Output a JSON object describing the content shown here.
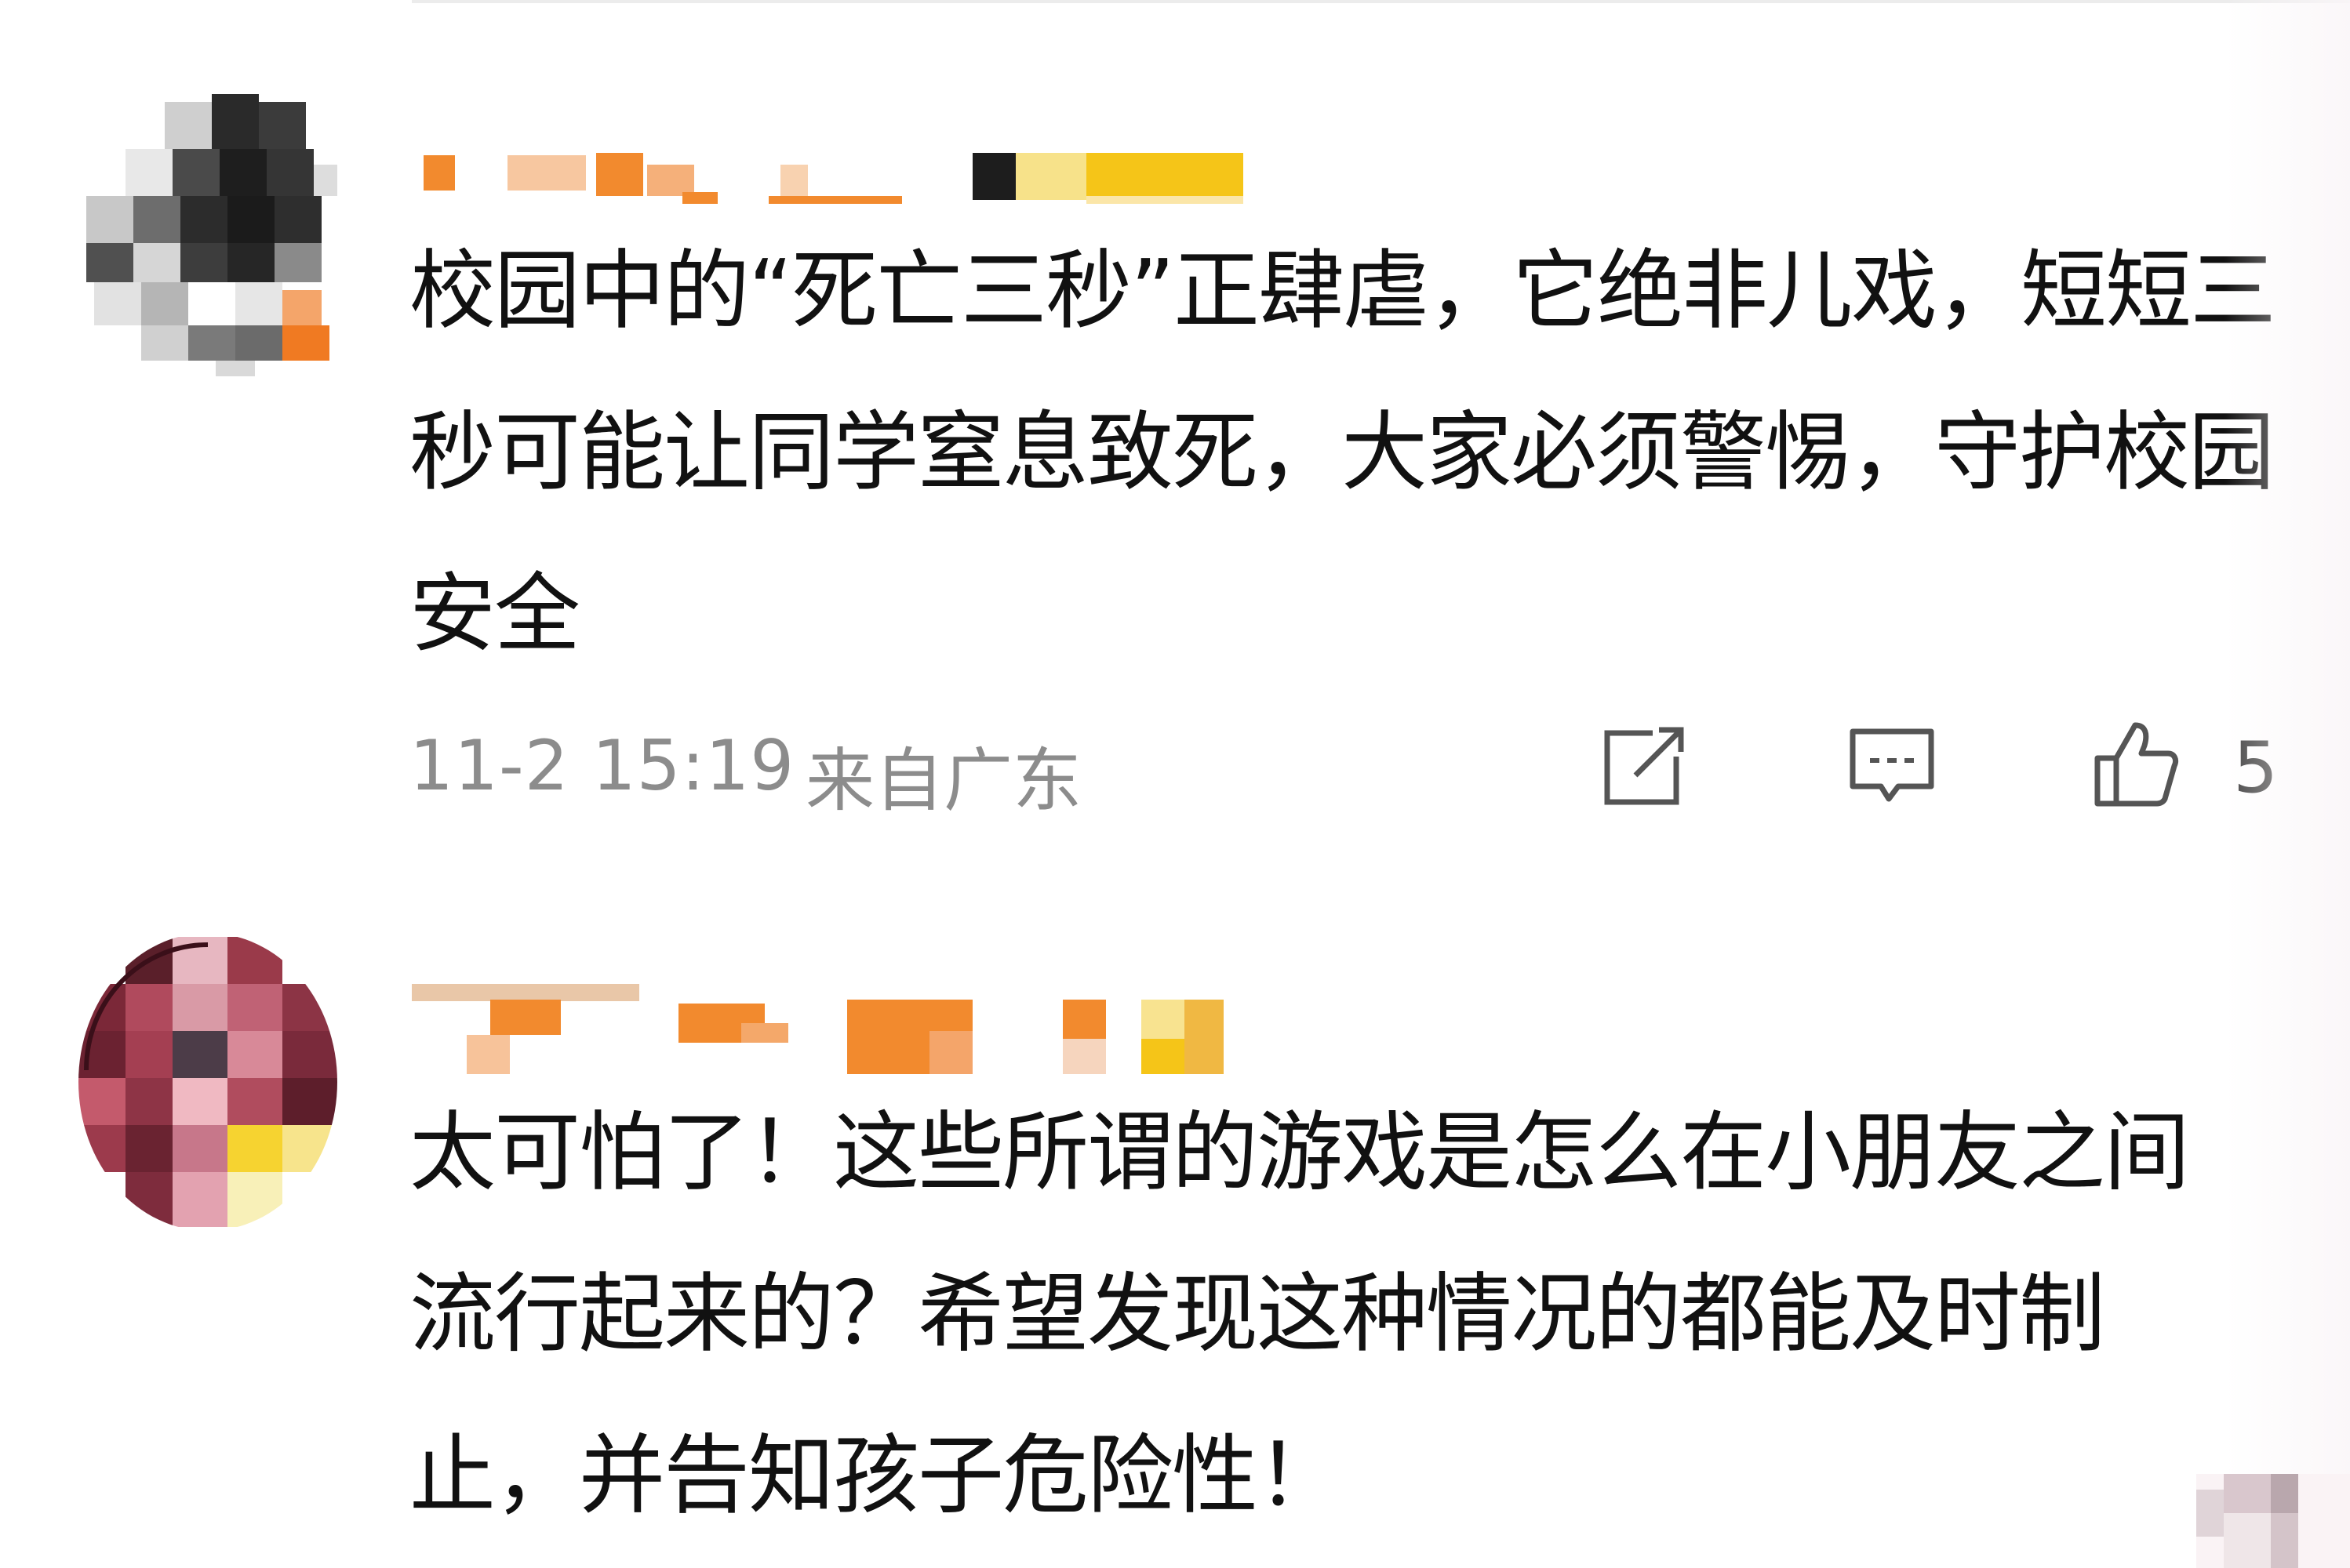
{
  "comments": [
    {
      "text": "校园中的“死亡三秒”正肆虐，它绝非儿戏，短短三秒可能让同学窒息致死，大家必须警惕，守护校园安全",
      "time": "11-2 15:19",
      "location": "来自广东",
      "likes": "5",
      "share_icon": "share-icon",
      "comment_icon": "comment-icon",
      "like_icon": "thumbs-up-icon"
    },
    {
      "text": "太可怕了！这些所谓的游戏是怎么在小朋友之间流行起来的？希望发现这种情况的都能及时制止，并告知孩子危险性！"
    }
  ],
  "colors": {
    "text": "#111111",
    "meta": "#8c8c8c",
    "icon": "#555555",
    "blur_orange": "#f28a2e",
    "blur_yellow": "#f5c518"
  }
}
